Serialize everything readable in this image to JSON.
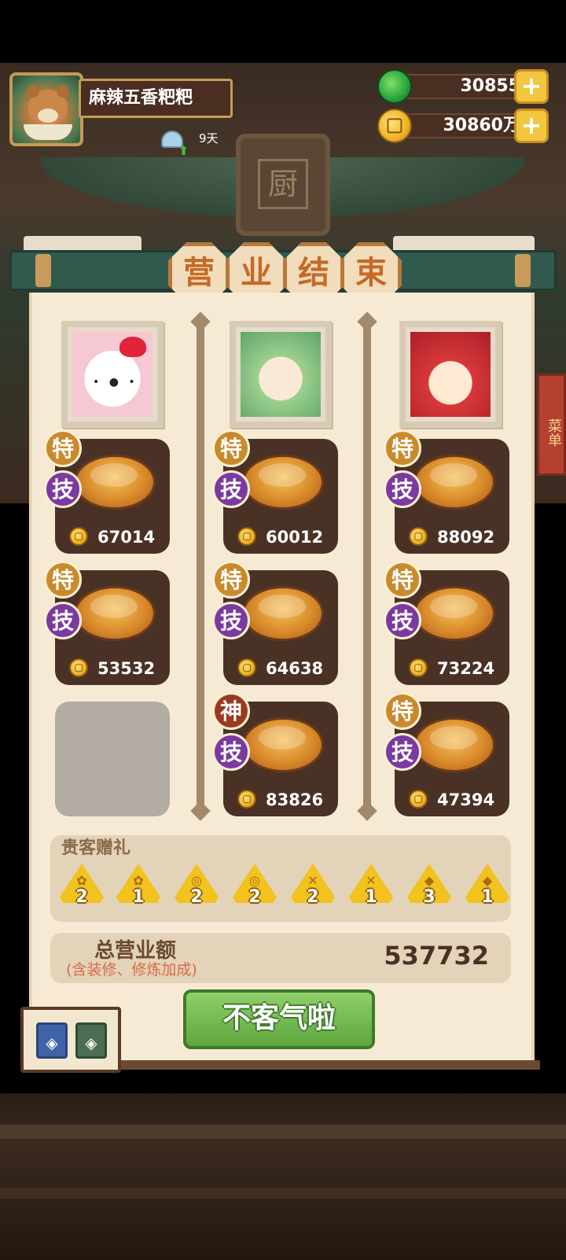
{
  "player": {
    "name": "麻辣五香粑粑",
    "days": "9天"
  },
  "resources": {
    "jade": "30855",
    "gold": "30860万",
    "plus": "+"
  },
  "background": {
    "sign_char": "厨",
    "menu_tag": "菜单"
  },
  "title_chars": [
    "营",
    "业",
    "结",
    "束"
  ],
  "guests": [
    {
      "name": "hello-kitty"
    },
    {
      "name": "green-haired-girl"
    },
    {
      "name": "red-haired-girl"
    }
  ],
  "dishes": [
    {
      "badge1": "特",
      "badge2": "技",
      "price": "67014"
    },
    {
      "badge1": "特",
      "badge2": "技",
      "price": "53532"
    },
    {
      "badge1": "特",
      "badge2": "技",
      "price": "60012"
    },
    {
      "badge1": "特",
      "badge2": "技",
      "price": "64638"
    },
    {
      "badge1": "神",
      "badge2": "技",
      "price": "83826"
    },
    {
      "badge1": "特",
      "badge2": "技",
      "price": "88092"
    },
    {
      "badge1": "特",
      "badge2": "技",
      "price": "73224"
    },
    {
      "badge1": "特",
      "badge2": "技",
      "price": "47394"
    }
  ],
  "gifts": {
    "label": "贵客赠礼",
    "items": [
      {
        "icon": "coral",
        "count": "2"
      },
      {
        "icon": "coral",
        "count": "1"
      },
      {
        "icon": "swirl",
        "count": "2"
      },
      {
        "icon": "swirl",
        "count": "2"
      },
      {
        "icon": "lantern",
        "count": "2"
      },
      {
        "icon": "lantern",
        "count": "1"
      },
      {
        "icon": "fish",
        "count": "3"
      },
      {
        "icon": "fish",
        "count": "1"
      }
    ]
  },
  "total": {
    "label": "总营业额",
    "note": "(含装修、修炼加成)",
    "value": "537732"
  },
  "button": {
    "confirm": "不客气啦"
  }
}
